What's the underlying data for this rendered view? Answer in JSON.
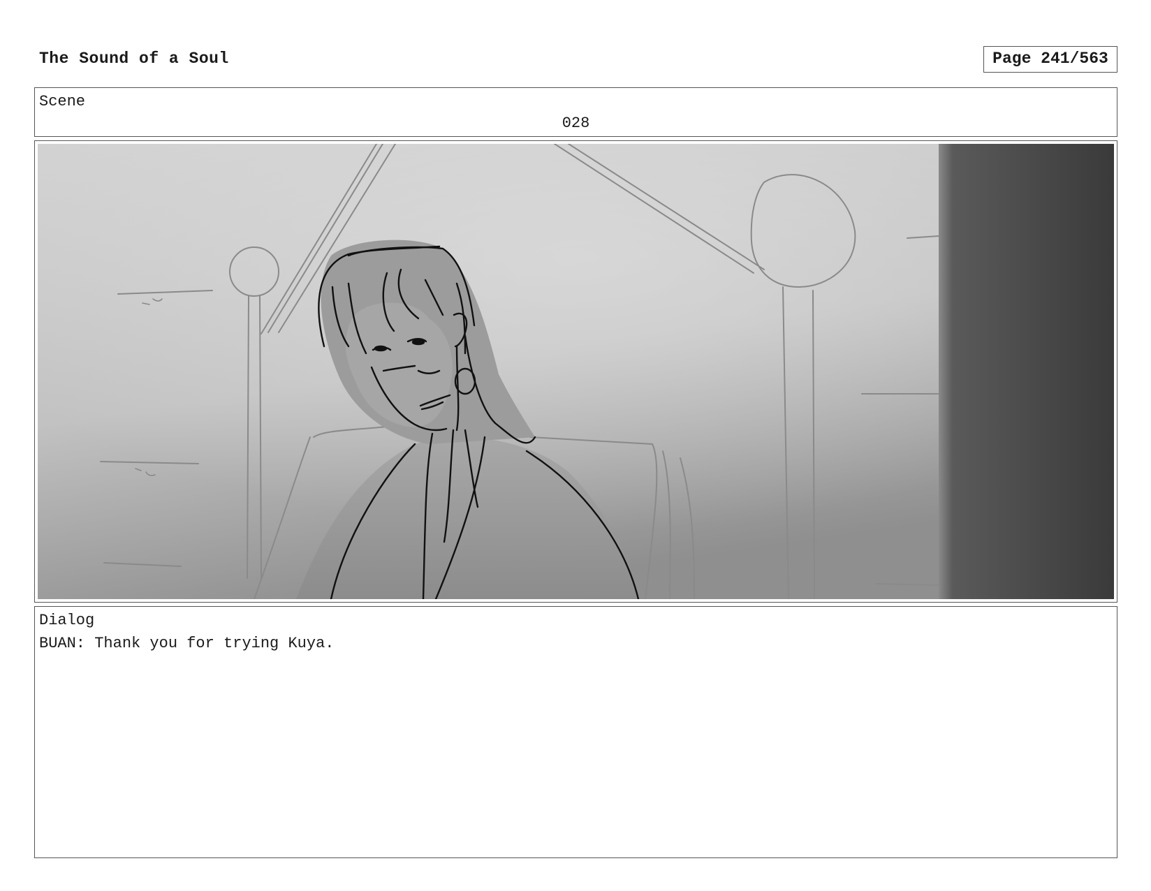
{
  "header": {
    "title": "The Sound of a Soul",
    "page": "Page 241/563"
  },
  "scene": {
    "label": "Scene",
    "number": "028"
  },
  "panel": {
    "image_icon": "storyboard-sketch",
    "colors": {
      "background_light": "#cfcfcf",
      "background_dark": "#8e8e8e",
      "doorway_dark": "#3e3e3e",
      "line": "#111111",
      "sketch_line": "#8a8a8a"
    }
  },
  "dialog": {
    "label": "Dialog",
    "text": "BUAN: Thank you for trying Kuya."
  }
}
